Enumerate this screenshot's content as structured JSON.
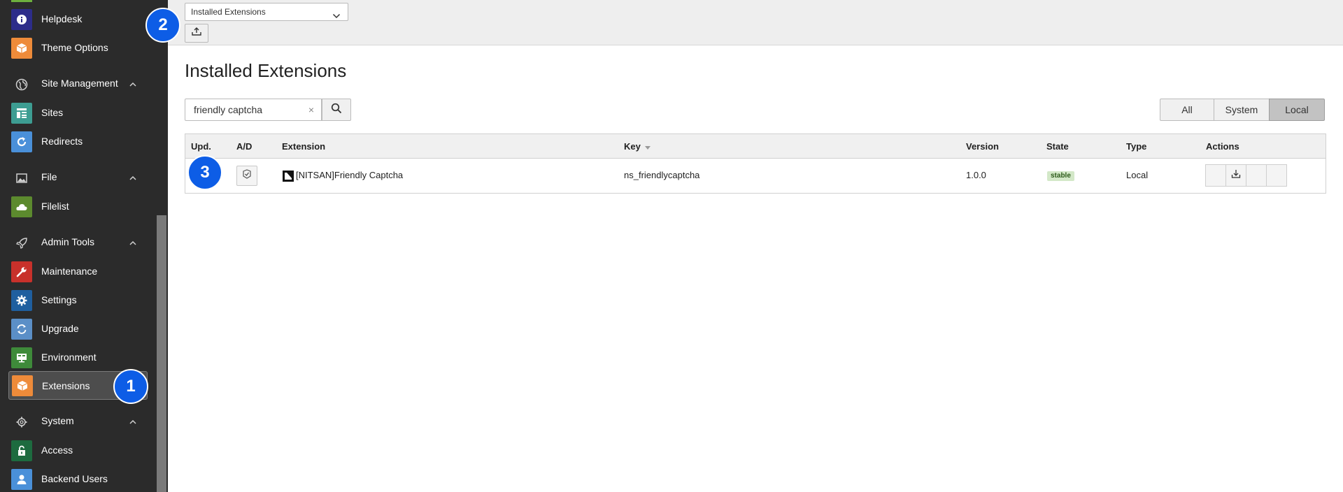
{
  "sidebar": {
    "items": [
      {
        "key": "helpdesk",
        "label": "Helpdesk",
        "color": "#2d2d8a",
        "icon": "info-icon"
      },
      {
        "key": "theme-options",
        "label": "Theme Options",
        "color": "#ee8b3a",
        "icon": "cube-icon"
      },
      {
        "key": "site-management",
        "label": "Site Management",
        "group": true,
        "icon": "globe-icon"
      },
      {
        "key": "sites",
        "label": "Sites",
        "color": "#3d9d92",
        "icon": "sites-icon"
      },
      {
        "key": "redirects",
        "label": "Redirects",
        "color": "#4a90d9",
        "icon": "redirect-icon"
      },
      {
        "key": "file",
        "label": "File",
        "group": true,
        "icon": "image-icon"
      },
      {
        "key": "filelist",
        "label": "Filelist",
        "color": "#5c8a2e",
        "icon": "cloud-icon"
      },
      {
        "key": "admin-tools",
        "label": "Admin Tools",
        "group": true,
        "icon": "rocket-icon"
      },
      {
        "key": "maintenance",
        "label": "Maintenance",
        "color": "#c8312b",
        "icon": "wrench-icon"
      },
      {
        "key": "settings",
        "label": "Settings",
        "color": "#1f5f9f",
        "icon": "gear-icon"
      },
      {
        "key": "upgrade",
        "label": "Upgrade",
        "color": "#5b8fc7",
        "icon": "refresh-icon"
      },
      {
        "key": "environment",
        "label": "Environment",
        "color": "#3e8a3a",
        "icon": "monitor-icon"
      },
      {
        "key": "extensions",
        "label": "Extensions",
        "color": "#ee8b3a",
        "icon": "cube-icon",
        "active": true
      },
      {
        "key": "system",
        "label": "System",
        "group": true,
        "icon": "gear-outline-icon"
      },
      {
        "key": "access",
        "label": "Access",
        "color": "#1d6b3f",
        "icon": "lock-icon"
      },
      {
        "key": "backend-users",
        "label": "Backend Users",
        "color": "#4a90d9",
        "icon": "user-icon"
      }
    ]
  },
  "header": {
    "menu_select": "Installed Extensions"
  },
  "main": {
    "title": "Installed Extensions",
    "search_value": "friendly captcha",
    "clear_glyph": "×",
    "filters": {
      "all": "All",
      "system": "System",
      "local": "Local"
    },
    "table": {
      "headers": {
        "upd": "Upd.",
        "ad": "A/D",
        "extension": "Extension",
        "key": "Key",
        "version": "Version",
        "state": "State",
        "type": "Type",
        "actions": "Actions"
      },
      "rows": [
        {
          "extension": "[NITSAN]Friendly Captcha",
          "key": "ns_friendlycaptcha",
          "version": "1.0.0",
          "state": "stable",
          "type": "Local"
        }
      ]
    }
  },
  "callouts": {
    "one": "1",
    "two": "2",
    "three": "3"
  },
  "colors": {
    "callout": "#0d5de6",
    "sidebar_bg": "#2b2b2b",
    "active_filter": "#c2c2c2",
    "stable_badge": "#d3e8c8"
  }
}
